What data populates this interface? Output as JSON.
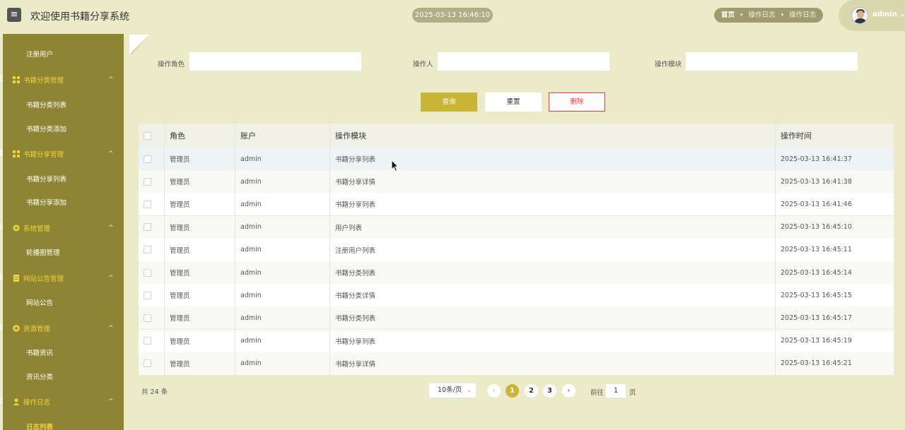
{
  "header": {
    "title": "欢迎使用书籍分享系统",
    "clock": "2025-03-13 16:46:10",
    "breadcrumbs": [
      "首页",
      "操作日志",
      "操作日志"
    ],
    "user": "admin"
  },
  "sidebar": {
    "top_item": "注册用户",
    "groups": [
      {
        "label": "书籍分类管理",
        "items": [
          "书籍分类列表",
          "书籍分类添加"
        ]
      },
      {
        "label": "书籍分享管理",
        "items": [
          "书籍分享列表",
          "书籍分享添加"
        ]
      },
      {
        "label": "系统管理",
        "items": [
          "轮播图管理"
        ]
      },
      {
        "label": "网站公告管理",
        "items": [
          "网站公告"
        ]
      },
      {
        "label": "资源管理",
        "items": [
          "书籍资讯",
          "资讯分类"
        ]
      },
      {
        "label": "操作日志",
        "items": [
          "日志列表"
        ]
      }
    ]
  },
  "filters": {
    "role_label": "操作角色",
    "operator_label": "操作人",
    "module_label": "操作模块",
    "role_value": "",
    "operator_value": "",
    "module_value": ""
  },
  "buttons": {
    "query": "查询",
    "reset": "重置",
    "delete": "删除"
  },
  "table": {
    "headers": [
      "角色",
      "账户",
      "操作模块",
      "操作时间"
    ],
    "rows": [
      {
        "role": "管理员",
        "account": "admin",
        "module": "书籍分享列表",
        "time": "2025-03-13 16:41:37"
      },
      {
        "role": "管理员",
        "account": "admin",
        "module": "书籍分享详情",
        "time": "2025-03-13 16:41:38"
      },
      {
        "role": "管理员",
        "account": "admin",
        "module": "书籍分享列表",
        "time": "2025-03-13 16:41:46"
      },
      {
        "role": "管理员",
        "account": "admin",
        "module": "用户列表",
        "time": "2025-03-13 16:45:10"
      },
      {
        "role": "管理员",
        "account": "admin",
        "module": "注册用户列表",
        "time": "2025-03-13 16:45:11"
      },
      {
        "role": "管理员",
        "account": "admin",
        "module": "书籍分类列表",
        "time": "2025-03-13 16:45:14"
      },
      {
        "role": "管理员",
        "account": "admin",
        "module": "书籍分类详情",
        "time": "2025-03-13 16:45:15"
      },
      {
        "role": "管理员",
        "account": "admin",
        "module": "书籍分类列表",
        "time": "2025-03-13 16:45:17"
      },
      {
        "role": "管理员",
        "account": "admin",
        "module": "书籍分享列表",
        "time": "2025-03-13 16:45:19"
      },
      {
        "role": "管理员",
        "account": "admin",
        "module": "书籍分享详情",
        "time": "2025-03-13 16:45:21"
      }
    ]
  },
  "pagination": {
    "total": "共 24 条",
    "page_size": "10条/页",
    "pages": [
      "1",
      "2",
      "3"
    ],
    "goto_label": "前往",
    "goto_value": "1",
    "page_unit": "页"
  },
  "colors": {
    "accent": "#c9b436",
    "sidebar": "#8e8534",
    "sidebar_group_text": "#f2d23c",
    "background": "#ecebc9",
    "danger": "#e53935"
  }
}
